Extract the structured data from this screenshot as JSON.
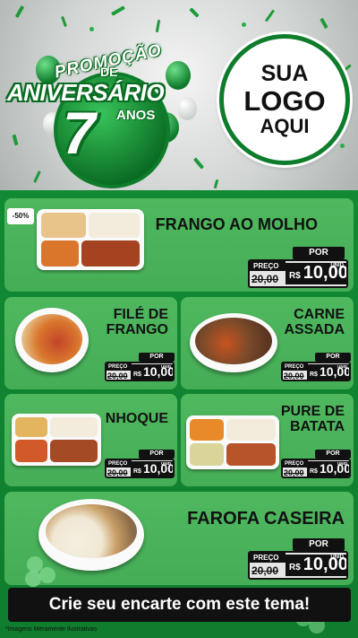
{
  "header": {
    "promo": {
      "line1": "PROMOÇÃO",
      "line2": "DE",
      "line3": "ANIVERSÁRIO",
      "number": "7",
      "line4": "ANOS"
    },
    "logo": {
      "line1": "SUA",
      "line2": "LOGO",
      "line3": "AQUI"
    }
  },
  "price_labels": {
    "por": "POR",
    "preco": "PREÇO",
    "currency": "R$",
    "unid": "UNID"
  },
  "discount_badge": "-50%",
  "products": [
    {
      "name": "FRANGO AO MOLHO",
      "old_price": "20,00",
      "price": "10,00"
    },
    {
      "name": "FILÉ DE FRANGO",
      "old_price": "20,00",
      "price": "10,00"
    },
    {
      "name": "CARNE ASSADA",
      "old_price": "20,00",
      "price": "10,00"
    },
    {
      "name": "NHOQUE",
      "old_price": "20,00",
      "price": "10,00"
    },
    {
      "name": "PURE DE BATATA",
      "old_price": "20,00",
      "price": "10,00"
    },
    {
      "name": "FAROFA CASEIRA",
      "old_price": "20,00",
      "price": "10,00"
    }
  ],
  "cta": "Crie seu encarte com este tema!",
  "disclaimer": "*Imagens Meramente Ilustrativas",
  "colors": {
    "brand_green": "#0e7d2b",
    "card_green": "#4fb85f",
    "text_dark": "#111111"
  }
}
